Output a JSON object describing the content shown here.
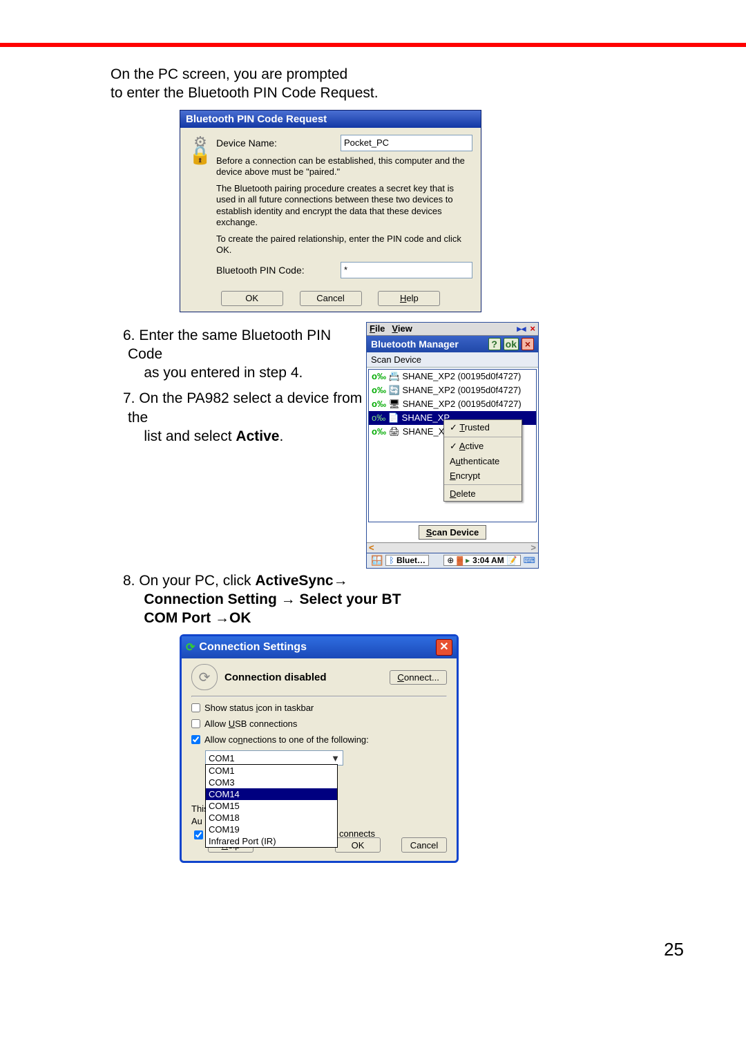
{
  "narrative": {
    "intro1": "On the PC screen, you are prompted",
    "intro2": " to enter the Bluetooth PIN Code Request.",
    "step6a": "6. Enter the same Bluetooth PIN Code",
    "step6b": "as you entered in step 4.",
    "step7a": "7. On the PA982 select a device from the",
    "step7b_prefix": "list and select ",
    "step7b_bold": "Active",
    "step7b_suffix": ".",
    "step8a_prefix": "8. On your PC, click ",
    "step8a_bold": "ActiveSync",
    "step8a_arrow": "→",
    "step8b": "Connection Setting → Select your BT",
    "step8c": "COM Port →OK"
  },
  "pin_dialog": {
    "title": "Bluetooth PIN Code Request",
    "device_label": "Device Name:",
    "device_value": "Pocket_PC",
    "para1": "Before a connection can be established, this computer and the device above must be \"paired.\"",
    "para2": "The Bluetooth pairing procedure creates a secret key that is used in all future connections between these two devices to establish identity and encrypt the data that these devices exchange.",
    "para3": "To create the paired relationship, enter the PIN code and click OK.",
    "pin_label": "Bluetooth PIN Code:",
    "pin_value": "*",
    "ok": "OK",
    "cancel": "Cancel",
    "help_first": "H",
    "help_rest": "elp"
  },
  "bt_mgr": {
    "menu_file_first": "F",
    "menu_file_rest": "ile",
    "menu_view_first": "V",
    "menu_view_rest": "iew",
    "title": "Bluetooth Manager",
    "help": "?",
    "ok": "ok",
    "close": "×",
    "sub": "Scan Device",
    "devlist": [
      "SHANE_XP2 (00195d0f4727)",
      "SHANE_XP2 (00195d0f4727)",
      "SHANE_XP2 (00195d0f4727)",
      "SHANE_XP",
      "SHANE_XP"
    ],
    "ctx": {
      "trusted_first": "T",
      "trusted_rest": "rusted",
      "active_first": "A",
      "active_rest": "ctive",
      "auth_a": "A",
      "auth_u": "u",
      "auth_rest": "thenticate",
      "encrypt_first": "E",
      "encrypt_rest": "ncrypt",
      "delete_first": "D",
      "delete_rest": "elete"
    },
    "scan_btn_first": "S",
    "scan_btn_rest": "can Device",
    "task_bt": "Bluet…",
    "task_time": "3:04 AM"
  },
  "conn_dialog": {
    "title": "Connection Settings",
    "status": "Connection disabled",
    "connect_first": "C",
    "connect_rest": "onnect...",
    "show_a": "Show status ",
    "show_i": "i",
    "show_b": "con in taskbar",
    "usb_a": "Allow ",
    "usb_u": "U",
    "usb_b": "SB connections",
    "follow_a": "Allow co",
    "follow_n": "n",
    "follow_b": "nections to one of the following:",
    "selected": "COM1",
    "options": [
      "COM1",
      "COM3",
      "COM14",
      "COM15",
      "COM18",
      "COM19",
      "Infrared Port (IR)"
    ],
    "highlight_index": 2,
    "behind_thi": "This",
    "behind_au": "Au",
    "behind_connects": "connects",
    "help_h": "H",
    "help_rest": "elp",
    "ok": "OK",
    "cancel": "Cancel"
  },
  "page_number": "25"
}
